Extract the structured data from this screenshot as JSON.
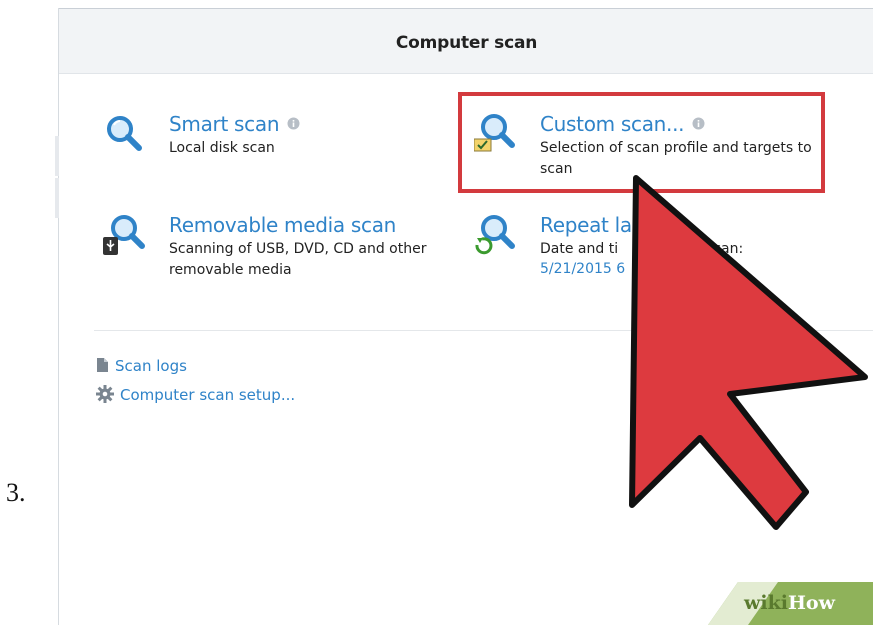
{
  "step": {
    "number": "3."
  },
  "window": {
    "title": "Computer scan"
  },
  "scans": [
    {
      "title": "Smart scan",
      "description": "Local disk scan",
      "icon": "magnifier-icon",
      "has_info": true
    },
    {
      "title": "Custom scan...",
      "description": "Selection of scan profile and targets to scan",
      "icon": "custom-scan-magnifier-icon",
      "has_info": true
    },
    {
      "title": "Removable media scan",
      "description": "Scanning of USB, DVD, CD and other removable media",
      "icon": "usb-magnifier-icon",
      "has_info": false
    },
    {
      "title": "Repeat la",
      "description": "Date and ti",
      "description_tail": "scan:",
      "link": "5/21/2015 6",
      "icon": "repeat-magnifier-icon",
      "has_info": false
    }
  ],
  "footer": {
    "scan_logs": "Scan logs",
    "setup": "Computer scan setup..."
  },
  "watermark": {
    "wiki": "wiki",
    "how": "How"
  },
  "colors": {
    "link_blue": "#2f83c8",
    "highlight_red": "#d33a3e",
    "cursor_red": "#dd3a3f",
    "watermark_green": "#8fb25a"
  }
}
